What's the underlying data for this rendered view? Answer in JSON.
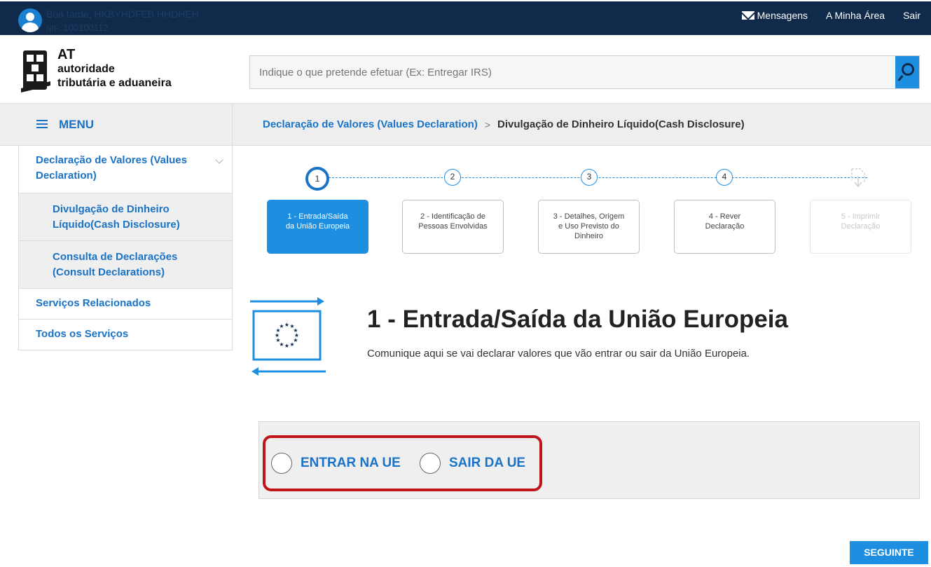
{
  "topbar": {
    "greeting": "Boa tarde, HKBYHDFEB HHDHEH",
    "nif_label": "NIF:",
    "nif_value": "100100112",
    "links": {
      "messages": "Mensagens",
      "my_area": "A Minha Área",
      "logout": "Sair"
    }
  },
  "logo": {
    "line1": "AT",
    "line2": "autoridade",
    "line3": "tributária e aduaneira"
  },
  "search": {
    "placeholder": "Indique o que pretende efetuar (Ex: Entregar IRS)"
  },
  "menu": {
    "label": "MENU"
  },
  "breadcrumb": {
    "parent": "Declaração de Valores (Values Declaration)",
    "separator": ">",
    "current": "Divulgação de Dinheiro Líquido(Cash Disclosure)"
  },
  "sidebar": {
    "items": [
      {
        "label": "Declaração de Valores (Values Declaration)"
      },
      {
        "label": "Divulgação de Dinheiro Líquido(Cash Disclosure)"
      },
      {
        "label": "Consulta de Declarações (Consult Declarations)"
      },
      {
        "label": "Serviços Relacionados"
      },
      {
        "label": "Todos os Serviços"
      }
    ]
  },
  "steps": [
    {
      "number": "1",
      "line1": "1 - Entrada/Saída",
      "line2": "da União Europeia",
      "line3": ""
    },
    {
      "number": "2",
      "line1": "2 - Identificação de",
      "line2": "Pessoas Envolvidas",
      "line3": ""
    },
    {
      "number": "3",
      "line1": "3 - Detalhes, Origem",
      "line2": "e Uso Previsto do",
      "line3": "Dinheiro"
    },
    {
      "number": "4",
      "line1": "4 - Rever",
      "line2": "Declaração",
      "line3": ""
    },
    {
      "number": "",
      "line1": "5 - Imprimir",
      "line2": "Declaração",
      "line3": ""
    }
  ],
  "section": {
    "title": "1 - Entrada/Saída da União Europeia",
    "subtitle": "Comunique aqui se vai declarar valores que vão entrar ou sair da União Europeia."
  },
  "options": {
    "enter": "ENTRAR NA UE",
    "exit": "SAIR DA UE"
  },
  "actions": {
    "next": "SEGUINTE"
  },
  "colors": {
    "navy": "#0f2a4a",
    "blue": "#1e8fe0",
    "link_blue": "#1a73c6",
    "highlight_red": "#c0151b"
  }
}
